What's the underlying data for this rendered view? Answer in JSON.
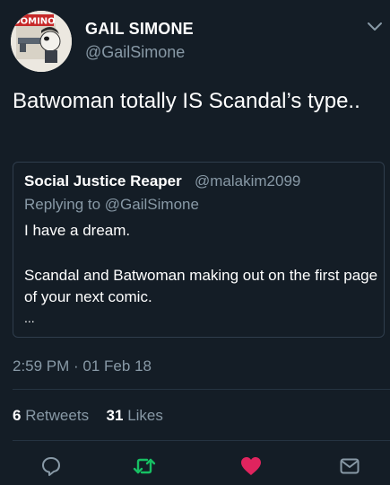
{
  "author": {
    "name": "GAIL SIMONE",
    "handle": "@GailSimone",
    "avatar_logo_text": "DOMINO"
  },
  "tweet": {
    "text": "Batwoman totally IS Scandal’s type.."
  },
  "quoted_tweet": {
    "name": "Social Justice Reaper",
    "handle": "@malakim2099",
    "replying_to_prefix": "Replying to",
    "replying_to_handle": "@GailSimone",
    "line1": "I have a dream.",
    "line2": "Scandal and Batwoman making out on the first page of your next comic.",
    "ellipsis": "..."
  },
  "timestamp": "2:59 PM · 01 Feb 18",
  "stats": {
    "retweets_count": "6",
    "retweets_label": "Retweets",
    "likes_count": "31",
    "likes_label": "Likes"
  },
  "actions": {
    "reply_icon": "reply-icon",
    "retweet_icon": "retweet-icon",
    "like_icon": "heart-icon",
    "dm_icon": "envelope-icon"
  },
  "colors": {
    "background": "#141d26",
    "secondary_text": "#8899a6",
    "retweet_green": "#17bf63",
    "like_red": "#e0245e",
    "divider": "#253341"
  }
}
